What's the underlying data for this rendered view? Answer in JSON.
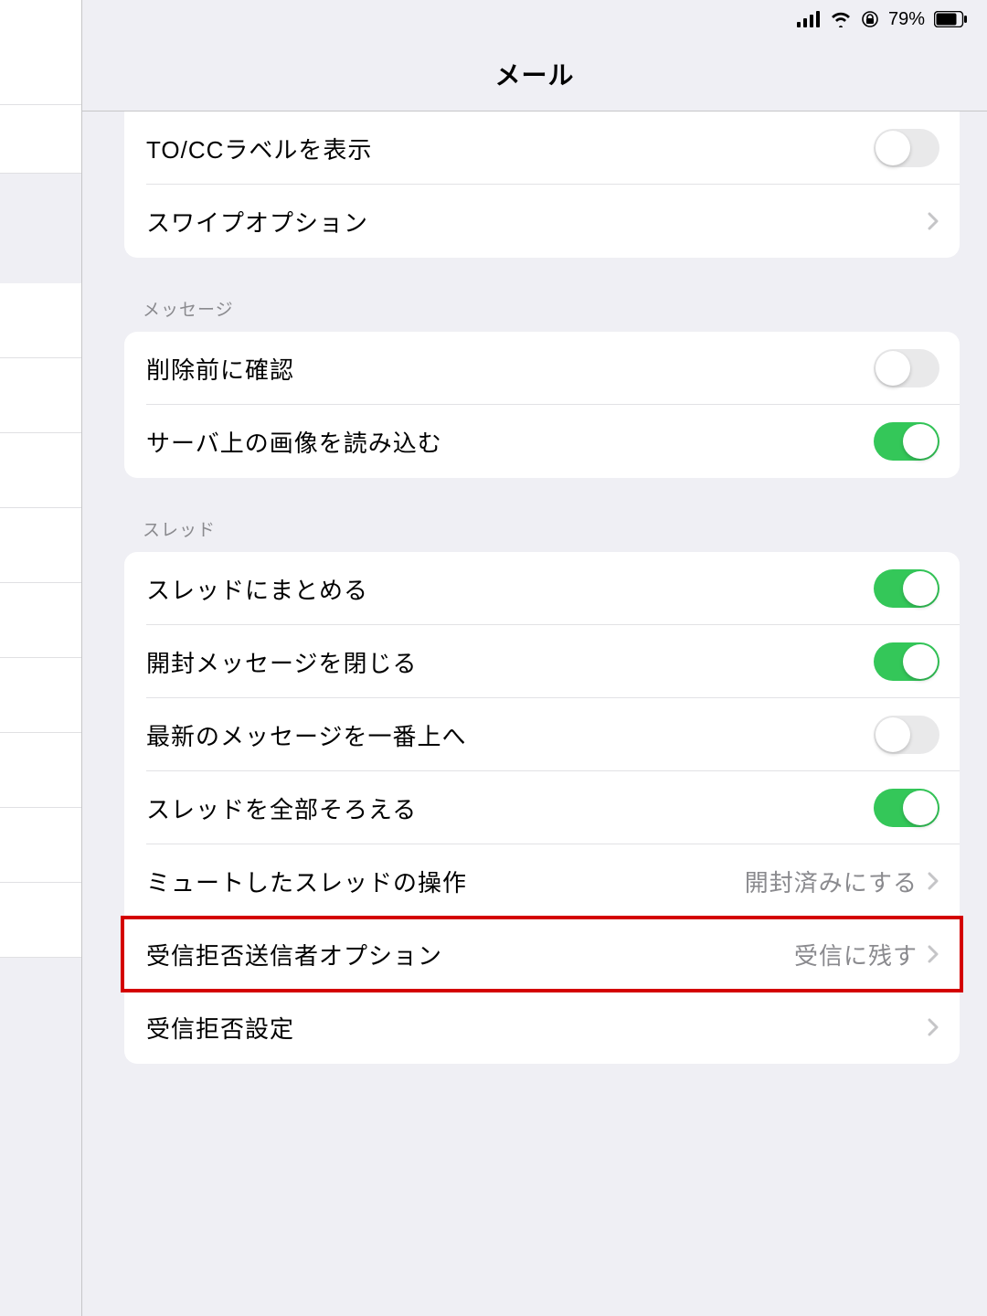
{
  "statusbar": {
    "battery_pct": "79%"
  },
  "header": {
    "title": "メール"
  },
  "groups": {
    "first": {
      "items": [
        {
          "label": "TO/CCラベルを表示",
          "type": "switch",
          "on": false
        },
        {
          "label": "スワイプオプション",
          "type": "disclosure"
        }
      ]
    },
    "message": {
      "title": "メッセージ",
      "items": [
        {
          "label": "削除前に確認",
          "type": "switch",
          "on": false
        },
        {
          "label": "サーバ上の画像を読み込む",
          "type": "switch",
          "on": true
        }
      ]
    },
    "thread": {
      "title": "スレッド",
      "items": [
        {
          "label": "スレッドにまとめる",
          "type": "switch",
          "on": true
        },
        {
          "label": "開封メッセージを閉じる",
          "type": "switch",
          "on": true
        },
        {
          "label": "最新のメッセージを一番上へ",
          "type": "switch",
          "on": false
        },
        {
          "label": "スレッドを全部そろえる",
          "type": "switch",
          "on": true
        },
        {
          "label": "ミュートしたスレッドの操作",
          "type": "detail",
          "value": "開封済みにする"
        },
        {
          "label": "受信拒否送信者オプション",
          "type": "detail",
          "value": "受信に残す",
          "highlighted": true
        },
        {
          "label": "受信拒否設定",
          "type": "disclosure"
        }
      ]
    }
  }
}
